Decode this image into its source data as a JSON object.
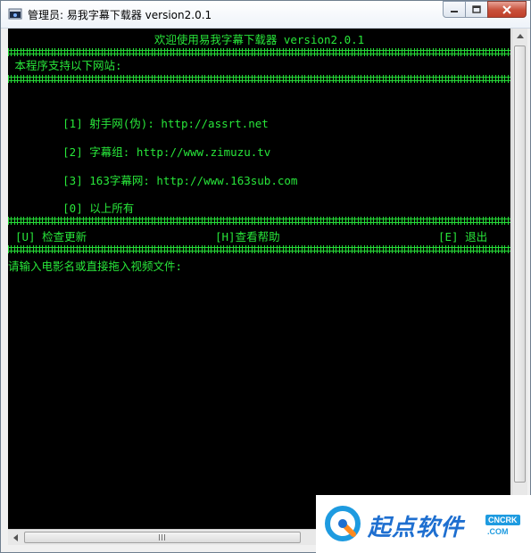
{
  "window": {
    "title": "管理员:  易我字幕下载器 version2.0.1",
    "icon": "console-app-icon"
  },
  "console": {
    "header_title": "欢迎使用易我字幕下载器 version2.0.1",
    "intro": " 本程序支持以下网站:",
    "sites": [
      {
        "key": "[1]",
        "label": "射手网(伪): http://assrt.net"
      },
      {
        "key": "[2]",
        "label": "字幕组: http://www.zimuzu.tv"
      },
      {
        "key": "[3]",
        "label": "163字幕网: http://www.163sub.com"
      },
      {
        "key": "[0]",
        "label": "以上所有"
      }
    ],
    "menu": {
      "update": "[U] 检查更新",
      "help": "[H]查看帮助",
      "exit": "[E] 退出"
    },
    "prompt": "请输入电影名或直接拖入视频文件:",
    "colors": {
      "foreground": "#28e63a",
      "background": "#000000"
    }
  },
  "watermark": {
    "brand": "起点软件",
    "badge": "CNCRK",
    "domain": ".COM"
  }
}
